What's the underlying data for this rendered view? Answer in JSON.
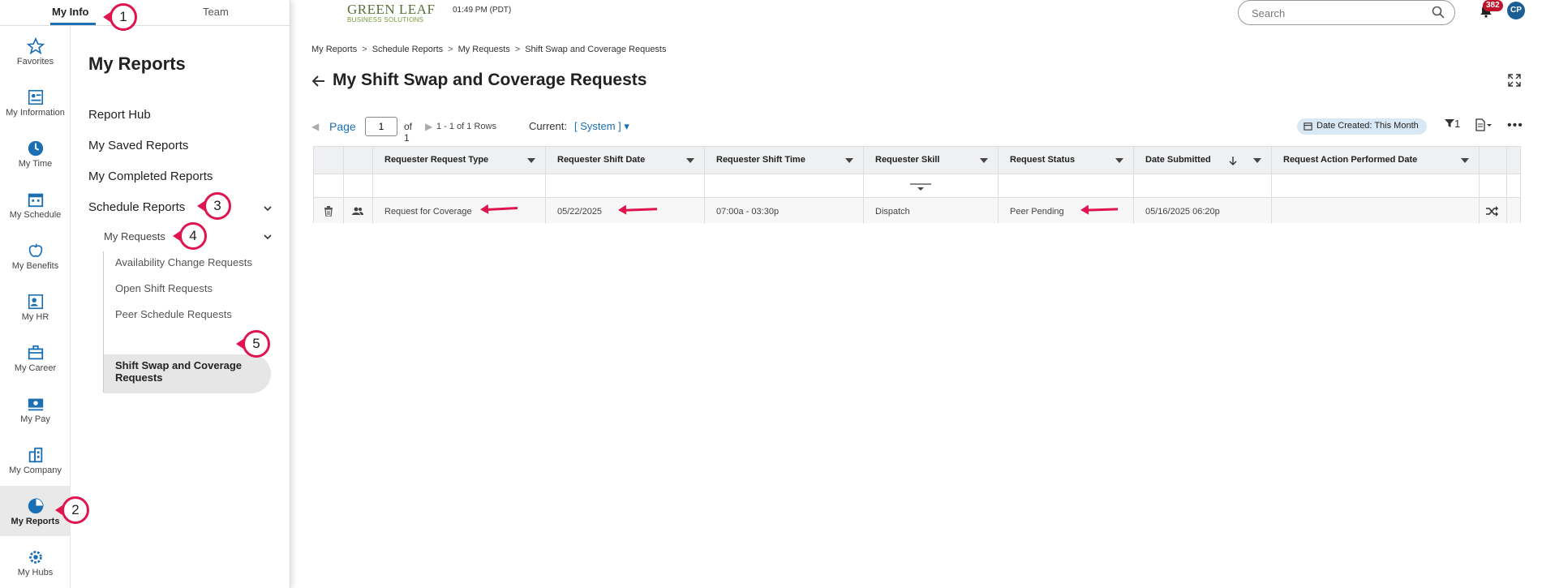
{
  "top_tabs": {
    "my_info": "My Info",
    "team": "Team"
  },
  "rail": [
    {
      "label": "Favorites",
      "icon": "star-icon"
    },
    {
      "label": "My Information",
      "icon": "id-card-icon"
    },
    {
      "label": "My Time",
      "icon": "clock-icon"
    },
    {
      "label": "My Schedule",
      "icon": "calendar-icon"
    },
    {
      "label": "My Benefits",
      "icon": "apple-icon"
    },
    {
      "label": "My HR",
      "icon": "hr-icon"
    },
    {
      "label": "My Career",
      "icon": "briefcase-icon"
    },
    {
      "label": "My Pay",
      "icon": "money-icon"
    },
    {
      "label": "My Company",
      "icon": "building-icon"
    },
    {
      "label": "My Reports",
      "icon": "pie-chart-icon",
      "active": true
    },
    {
      "label": "My Hubs",
      "icon": "hub-gear-icon"
    }
  ],
  "reports_menu": {
    "title": "My Reports",
    "report_hub": "Report Hub",
    "saved": "My Saved Reports",
    "completed": "My Completed Reports",
    "schedule": "Schedule Reports",
    "my_requests": "My Requests",
    "leaves": [
      "Availability Change Requests",
      "Open Shift Requests",
      "Peer Schedule Requests"
    ],
    "active_leaf": "Shift Swap and Coverage Requests"
  },
  "annotations": [
    "1",
    "2",
    "3",
    "4",
    "5"
  ],
  "header": {
    "logo_main": "GREEN LEAF",
    "logo_sub": "BUSINESS SOLUTIONS",
    "clock": "01:49 PM (PDT)",
    "search_placeholder": "Search",
    "notification_count": "382",
    "avatar_initials": "CP"
  },
  "breadcrumb": [
    "My Reports",
    "Schedule Reports",
    "My Requests",
    "Shift Swap and Coverage Requests"
  ],
  "page_title": "My Shift Swap and Coverage Requests",
  "pager": {
    "page_label": "Page",
    "page_value": "1",
    "of": "of 1",
    "rows": "1 - 1 of 1 Rows",
    "current_label": "Current:",
    "current_value": "[ System ]"
  },
  "toolbar": {
    "filter_chip": "Date Created: This Month",
    "filter_count": "1"
  },
  "table": {
    "columns": [
      "Requester Request Type",
      "Requester Shift Date",
      "Requester Shift Time",
      "Requester Skill",
      "Request Status",
      "Date Submitted",
      "Request Action Performed Date"
    ],
    "rows": [
      [
        "Request for Coverage",
        "05/22/2025",
        "07:00a - 03:30p",
        "Dispatch",
        "Peer Pending",
        "05/16/2025 06:20p",
        ""
      ]
    ]
  },
  "colors": {
    "accent": "#1a6fb5",
    "annotation": "#e0144f",
    "badge": "#c0132b"
  }
}
